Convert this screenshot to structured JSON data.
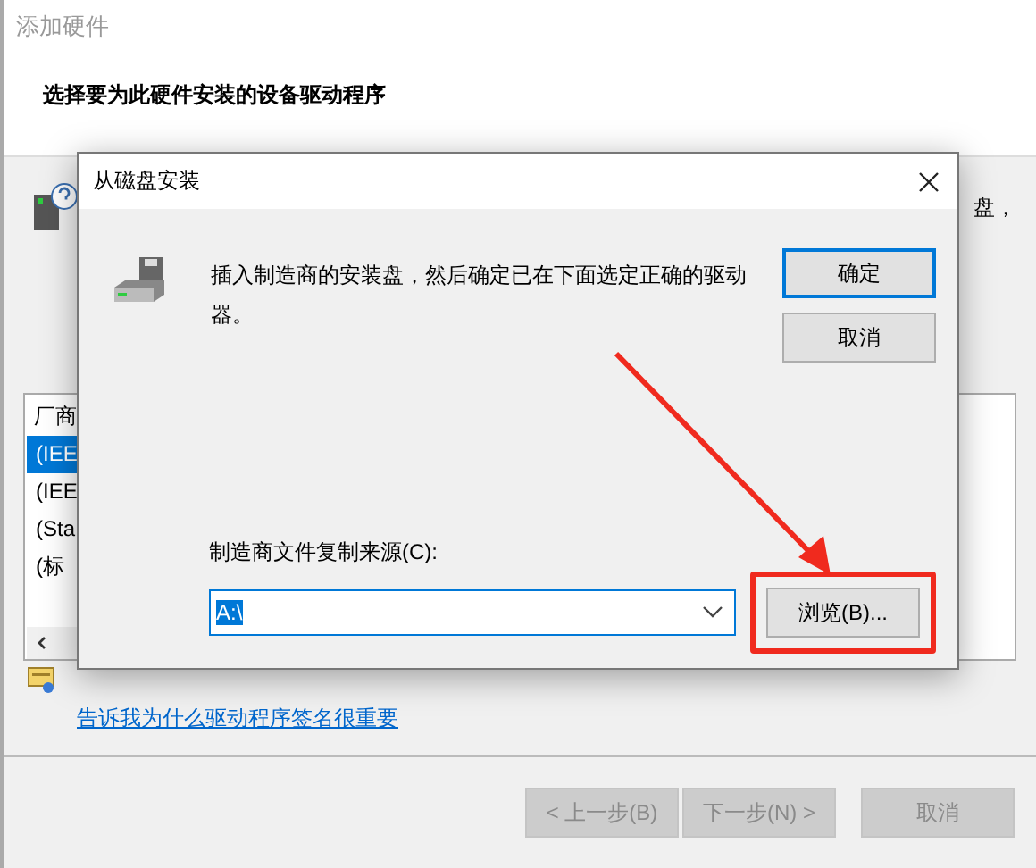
{
  "wizard": {
    "title": "添加硬件",
    "heading": "选择要为此硬件安装的设备驱动程序",
    "side_text": "盘，",
    "list": {
      "header": "厂商",
      "items": [
        {
          "label": "(IEE",
          "selected": true
        },
        {
          "label": "(IEE",
          "selected": false
        },
        {
          "label": "(Sta",
          "selected": false
        },
        {
          "label": "(标",
          "selected": false
        }
      ]
    },
    "link": "告诉我为什么驱动程序签名很重要",
    "buttons": [
      {
        "label": "< 上一步(B)",
        "disabled": true
      },
      {
        "label": "下一步(N) >",
        "disabled": true
      },
      {
        "label": "取消",
        "disabled": true
      }
    ]
  },
  "dialog": {
    "title": "从磁盘安装",
    "message": "插入制造商的安装盘，然后确定已在下面选定正确的驱动器。",
    "buttons": [
      {
        "label": "确定",
        "default": true
      },
      {
        "label": "取消",
        "default": false
      }
    ],
    "source_label": "制造商文件复制来源(C):",
    "source_value": "A:\\",
    "browse_button": "浏览(B)...",
    "browse_highlighted": true
  }
}
